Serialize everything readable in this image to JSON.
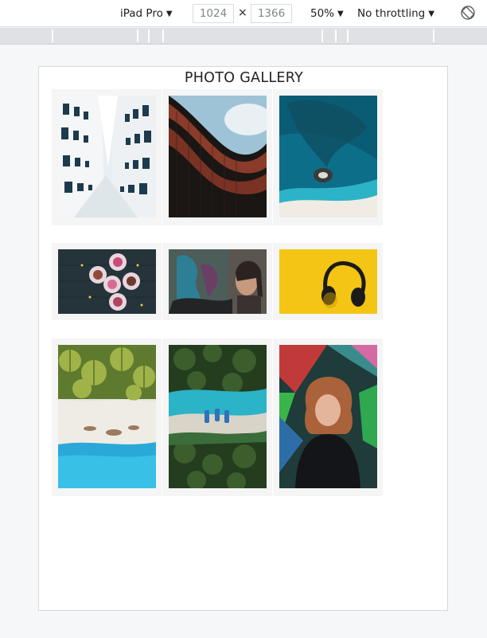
{
  "devtools": {
    "device": "iPad Pro",
    "width": "1024",
    "height": "1366",
    "zoom": "50%",
    "throttling": "No throttling",
    "arrow": "▼",
    "times": "×"
  },
  "page": {
    "title": "PHOTO GALLERY"
  },
  "gallery": {
    "rows": [
      {
        "photos": [
          "building-fisheye",
          "curved-facade",
          "aerial-reef"
        ]
      },
      {
        "photos": [
          "cupcakes",
          "graffiti-woman",
          "headphones"
        ]
      },
      {
        "photos": [
          "palm-beach-aerial",
          "jungle-beach-aerial",
          "girl-mural"
        ]
      }
    ]
  }
}
